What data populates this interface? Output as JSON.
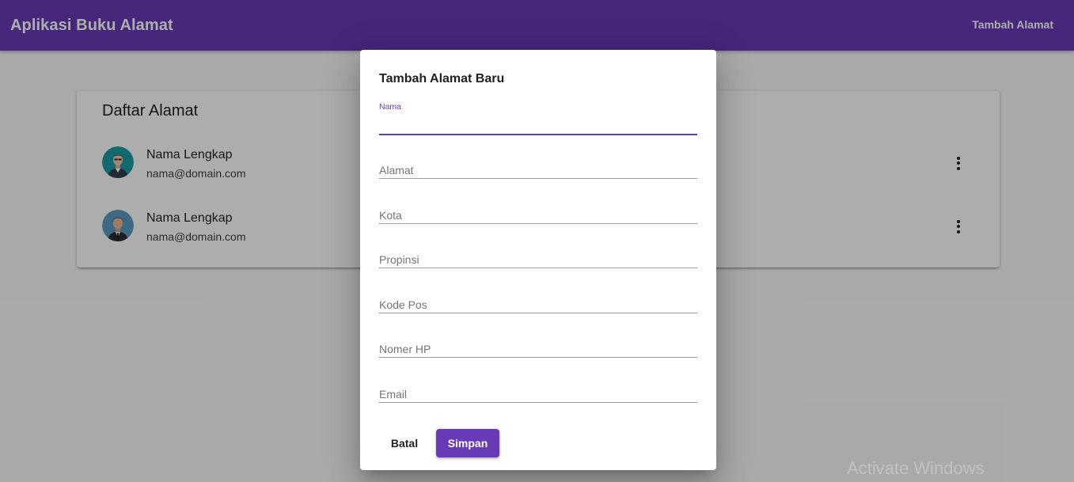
{
  "appbar": {
    "title": "Aplikasi Buku Alamat",
    "action_label": "Tambah Alamat"
  },
  "list": {
    "title": "Daftar Alamat",
    "items": [
      {
        "name": "Nama Lengkap",
        "email": "nama@domain.com",
        "avatar_icon": "person-avatar-icon",
        "avatar_bg": "#1e9aa6"
      },
      {
        "name": "Nama Lengkap",
        "email": "nama@domain.com",
        "avatar_icon": "businessman-avatar-icon",
        "avatar_bg": "#5b9bc1"
      }
    ]
  },
  "dialog": {
    "title": "Tambah Alamat Baru",
    "fields": {
      "nama": {
        "label": "Nama",
        "value": ""
      },
      "alamat": {
        "placeholder": "Alamat",
        "value": ""
      },
      "kota": {
        "placeholder": "Kota",
        "value": ""
      },
      "propinsi": {
        "placeholder": "Propinsi",
        "value": ""
      },
      "kode_pos": {
        "placeholder": "Kode Pos",
        "value": ""
      },
      "nomer_hp": {
        "placeholder": "Nomer HP",
        "value": ""
      },
      "email": {
        "placeholder": "Email",
        "value": ""
      }
    },
    "cancel_label": "Batal",
    "save_label": "Simpan"
  },
  "watermark": "Activate Windows",
  "colors": {
    "primary": "#673ab7",
    "overlay": "rgba(0,0,0,0.32)"
  }
}
